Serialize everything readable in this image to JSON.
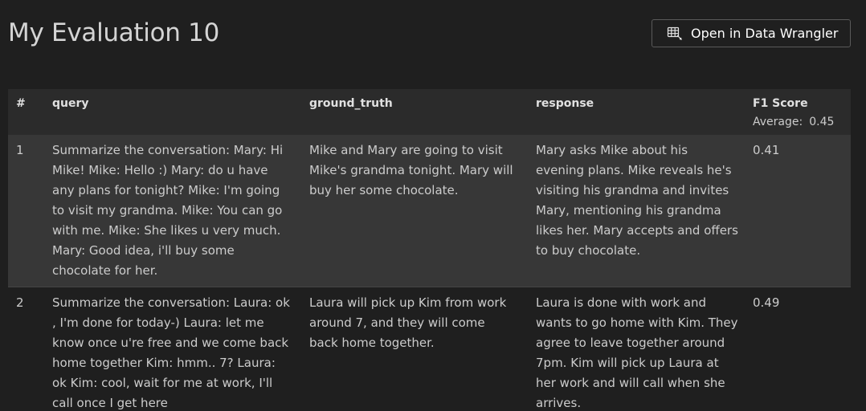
{
  "title": "My Evaluation 10",
  "open_button": {
    "label": "Open in Data Wrangler",
    "icon": "data-wrangler-icon"
  },
  "table": {
    "columns": {
      "num": "#",
      "query": "query",
      "ground_truth": "ground_truth",
      "response": "response",
      "f1": "F1 Score"
    },
    "average_label": "Average:",
    "average_value": "0.45",
    "rows": [
      {
        "num": "1",
        "query": "Summarize the conversation: Mary: Hi Mike! Mike: Hello :) Mary: do u have any plans for tonight? Mike: I'm going to visit my grandma. Mike: You can go with me. Mike: She likes u very much. Mary: Good idea, i'll buy some chocolate for her.",
        "ground_truth": "Mike and Mary are going to visit Mike's grandma tonight. Mary will buy her some chocolate.",
        "response": "Mary asks Mike about his evening plans. Mike reveals he's visiting his grandma and invites Mary, mentioning his grandma likes her. Mary accepts and offers to buy chocolate.",
        "f1": "0.41"
      },
      {
        "num": "2",
        "query": "Summarize the conversation: Laura: ok , I'm done for today-) Laura: let me know once u're free and we come back home together Kim: hmm.. 7? Laura: ok Kim: cool, wait for me at work, I'll call once I get here",
        "ground_truth": "Laura will pick up Kim from work around 7, and they will come back home together.",
        "response": "Laura is done with work and wants to go home with Kim. They agree to leave together around 7pm. Kim will pick up Laura at her work and will call when she arrives.",
        "f1": "0.49"
      }
    ]
  }
}
